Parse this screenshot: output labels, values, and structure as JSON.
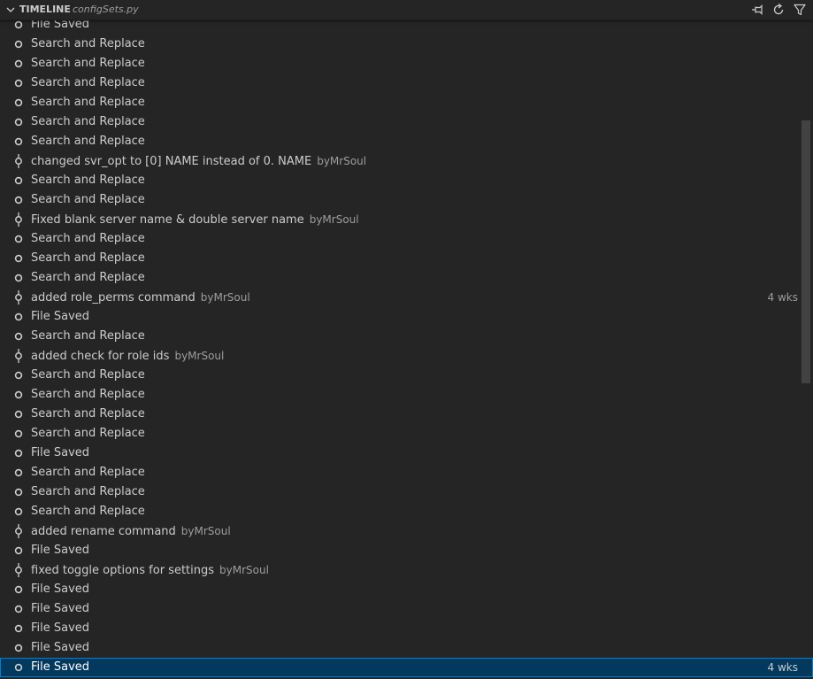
{
  "header": {
    "title": "TIMELINE",
    "file": "configSets.py"
  },
  "rows": [
    {
      "type": "file",
      "label": "File Saved",
      "author": "",
      "time": ""
    },
    {
      "type": "file",
      "label": "Search and Replace",
      "author": "",
      "time": ""
    },
    {
      "type": "file",
      "label": "Search and Replace",
      "author": "",
      "time": ""
    },
    {
      "type": "file",
      "label": "Search and Replace",
      "author": "",
      "time": ""
    },
    {
      "type": "file",
      "label": "Search and Replace",
      "author": "",
      "time": ""
    },
    {
      "type": "file",
      "label": "Search and Replace",
      "author": "",
      "time": ""
    },
    {
      "type": "file",
      "label": "Search and Replace",
      "author": "",
      "time": ""
    },
    {
      "type": "commit",
      "label": "changed svr_opt to [0] NAME instead of 0. NAME",
      "author": "byMrSoul",
      "time": ""
    },
    {
      "type": "file",
      "label": "Search and Replace",
      "author": "",
      "time": ""
    },
    {
      "type": "file",
      "label": "Search and Replace",
      "author": "",
      "time": ""
    },
    {
      "type": "commit",
      "label": "Fixed blank server name & double server name",
      "author": "byMrSoul",
      "time": ""
    },
    {
      "type": "file",
      "label": "Search and Replace",
      "author": "",
      "time": ""
    },
    {
      "type": "file",
      "label": "Search and Replace",
      "author": "",
      "time": ""
    },
    {
      "type": "file",
      "label": "Search and Replace",
      "author": "",
      "time": ""
    },
    {
      "type": "commit",
      "label": "added role_perms command",
      "author": "byMrSoul",
      "time": "4 wks"
    },
    {
      "type": "file",
      "label": "File Saved",
      "author": "",
      "time": ""
    },
    {
      "type": "file",
      "label": "Search and Replace",
      "author": "",
      "time": ""
    },
    {
      "type": "commit",
      "label": "added check for role ids",
      "author": "byMrSoul",
      "time": ""
    },
    {
      "type": "file",
      "label": "Search and Replace",
      "author": "",
      "time": ""
    },
    {
      "type": "file",
      "label": "Search and Replace",
      "author": "",
      "time": ""
    },
    {
      "type": "file",
      "label": "Search and Replace",
      "author": "",
      "time": ""
    },
    {
      "type": "file",
      "label": "Search and Replace",
      "author": "",
      "time": ""
    },
    {
      "type": "file",
      "label": "File Saved",
      "author": "",
      "time": ""
    },
    {
      "type": "file",
      "label": "Search and Replace",
      "author": "",
      "time": ""
    },
    {
      "type": "file",
      "label": "Search and Replace",
      "author": "",
      "time": ""
    },
    {
      "type": "file",
      "label": "Search and Replace",
      "author": "",
      "time": ""
    },
    {
      "type": "commit",
      "label": "added rename command",
      "author": "byMrSoul",
      "time": ""
    },
    {
      "type": "file",
      "label": "File Saved",
      "author": "",
      "time": ""
    },
    {
      "type": "commit",
      "label": "fixed toggle options for settings",
      "author": "byMrSoul",
      "time": ""
    },
    {
      "type": "file",
      "label": "File Saved",
      "author": "",
      "time": ""
    },
    {
      "type": "file",
      "label": "File Saved",
      "author": "",
      "time": ""
    },
    {
      "type": "file",
      "label": "File Saved",
      "author": "",
      "time": ""
    },
    {
      "type": "file",
      "label": "File Saved",
      "author": "",
      "time": ""
    },
    {
      "type": "file",
      "label": "File Saved",
      "author": "",
      "time": "4 wks",
      "selected": true
    }
  ],
  "icons": {
    "collapse": "chevron-down-icon",
    "pin": "pin-icon",
    "refresh": "refresh-icon",
    "filter": "filter-icon",
    "file_event": "circle-icon",
    "commit_event": "git-commit-icon"
  },
  "colors": {
    "background": "#252526",
    "text": "#cccccc",
    "muted": "#9d9d9d",
    "selection": "#04395e",
    "selection_border": "#007fd4"
  }
}
